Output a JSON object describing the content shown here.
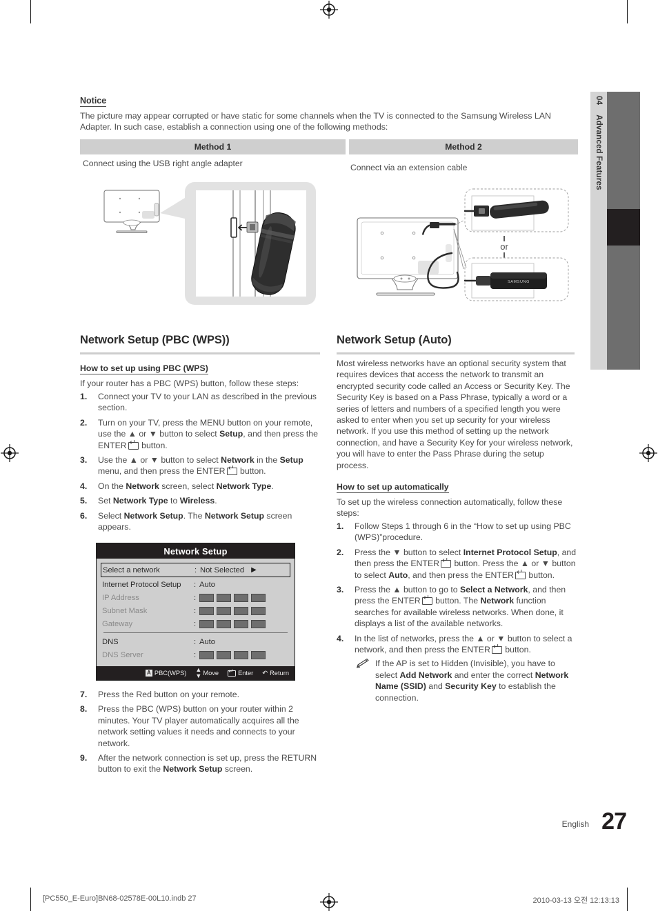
{
  "page": {
    "language": "English",
    "number": "27",
    "chapter_number": "04",
    "chapter_title": "Advanced Features"
  },
  "notice": {
    "heading": "Notice",
    "body": "The picture may appear corrupted  or have static for some channels when the TV is connected to the Samsung Wireless LAN Adapter. In such case, establish a connection using one of the following methods:"
  },
  "methods": {
    "method1_header": "Method 1",
    "method1_caption": "Connect using the USB right angle adapter",
    "method2_header": "Method 2",
    "method2_caption": "Connect via an extension cable",
    "or_label": "or",
    "brand_label": "SAMSUNG"
  },
  "left_section": {
    "title": "Network Setup (PBC (WPS))",
    "subhead": "How to set up using PBC (WPS)",
    "intro": "If your router has a PBC (WPS) button, follow these steps:",
    "steps": [
      {
        "num": "1.",
        "text": "Connect your TV to your LAN as described in the previous section."
      },
      {
        "num": "2.",
        "text": "Turn on your TV, press the MENU button on your remote, use the ▲ or ▼ button to select Setup, and then press the ENTER button."
      },
      {
        "num": "3.",
        "text": "Use the ▲ or ▼ button to select Network in the Setup menu, and then press the ENTER button."
      },
      {
        "num": "4.",
        "text": "On the Network screen, select Network Type."
      },
      {
        "num": "5.",
        "text": "Set Network Type to Wireless."
      },
      {
        "num": "6.",
        "text": "Select Network Setup. The Network Setup screen appears."
      }
    ],
    "steps_after": [
      {
        "num": "7.",
        "text": "Press the Red button on your remote."
      },
      {
        "num": "8.",
        "text": "Press the PBC (WPS) button on your router within 2 minutes. Your TV player automatically acquires all the network setting values it needs and connects to your network."
      },
      {
        "num": "9.",
        "text": "After the network connection is set up, press the RETURN button to exit the Network Setup screen."
      }
    ]
  },
  "right_section": {
    "title": "Network Setup (Auto)",
    "intro": "Most wireless networks have an optional security system that requires devices that access the network to transmit an encrypted security code called an Access or Security Key. The Security Key is based on a Pass Phrase, typically a word or a series of letters and numbers of a specified length you were asked to enter when you set up security for your wireless network.  If you use this method of setting up the network connection, and have a Security Key for your wireless network, you will have to enter the Pass Phrase during the setup process.",
    "subhead": "How to set up automatically",
    "intro2": "To set up the wireless connection automatically, follow these steps:",
    "steps": [
      {
        "num": "1.",
        "text": "Follow Steps 1 through 6 in the “How to set up using PBC (WPS)”procedure."
      },
      {
        "num": "2.",
        "text": "Press the ▼ button to select Internet Protocol Setup, and then press the ENTER button. Press the ▲ or ▼ button to select Auto, and then press the ENTER button."
      },
      {
        "num": "3.",
        "text": "Press the ▲ button to go to Select a Network, and then press the ENTER button. The Network function searches for available wireless networks. When done, it displays a list of the available networks."
      },
      {
        "num": "4.",
        "text": "In the list of networks, press the ▲ or ▼ button to select a network, and then press the ENTER button."
      }
    ],
    "note": "If the AP is set to Hidden (Invisible), you have to select Add Network and enter the correct Network Name (SSID) and Security Key to establish the connection."
  },
  "osd": {
    "title": "Network Setup",
    "rows": [
      {
        "label": "Select a network",
        "value": "Not Selected",
        "type": "value",
        "selected": true,
        "dim": false,
        "arrow": true
      },
      {
        "label": "Internet Protocol Setup",
        "value": "Auto",
        "type": "value",
        "selected": false,
        "dim": false,
        "arrow": false
      },
      {
        "label": "IP Address",
        "value": "",
        "type": "octets",
        "selected": false,
        "dim": true,
        "arrow": false
      },
      {
        "label": "Subnet Mask",
        "value": "",
        "type": "octets",
        "selected": false,
        "dim": true,
        "arrow": false
      },
      {
        "label": "Gateway",
        "value": "",
        "type": "octets",
        "selected": false,
        "dim": true,
        "arrow": false
      },
      {
        "label": "DNS",
        "value": "Auto",
        "type": "value",
        "selected": false,
        "dim": false,
        "arrow": false,
        "separator_before": true
      },
      {
        "label": "DNS Server",
        "value": "",
        "type": "octets",
        "selected": false,
        "dim": true,
        "arrow": false
      }
    ],
    "footer": [
      {
        "key": "A",
        "label": "PBC(WPS)",
        "icon": "letter-a-key-icon"
      },
      {
        "key": "",
        "label": "Move",
        "icon": "up-down-arrow-icon"
      },
      {
        "key": "",
        "label": "Enter",
        "icon": "enter-key-icon"
      },
      {
        "key": "",
        "label": "Return",
        "icon": "return-arrow-icon"
      }
    ],
    "colon": ":"
  },
  "imprint": {
    "left": "[PC550_E-Euro]BN68-02578E-00L10.indb   27",
    "right": "2010-03-13   오전 12:13:13"
  },
  "colors": {
    "table_header_bg": "#cfcfcf",
    "osd_bg": "#cfcfcf",
    "osd_title_bg": "#231f20",
    "side_tab_bg": "#d4d4d4",
    "side_bar_bg": "#6e6e6e",
    "side_bar_active": "#231f20",
    "text": "#4b4b4b",
    "rule": "#cdcdcd"
  }
}
